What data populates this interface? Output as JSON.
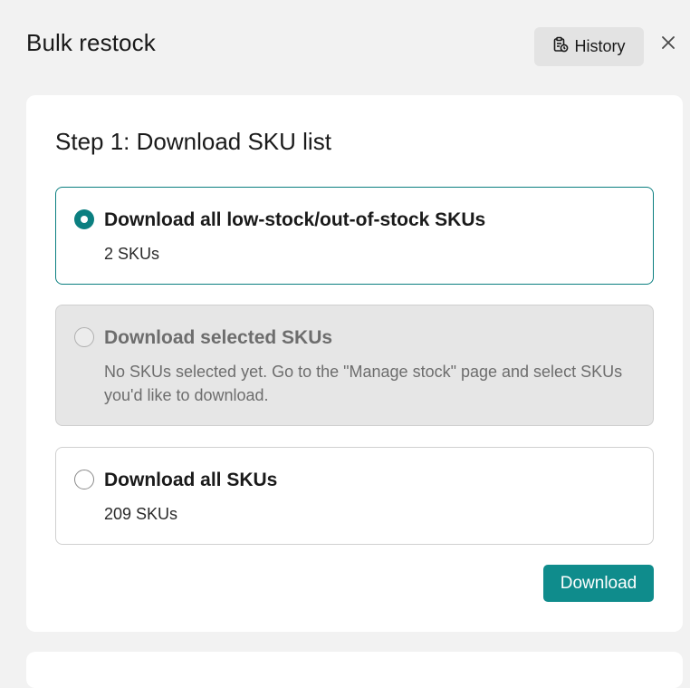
{
  "dialog": {
    "title": "Bulk restock",
    "history_label": "History"
  },
  "step1": {
    "title": "Step 1: Download SKU list",
    "options": [
      {
        "label": "Download all low-stock/out-of-stock SKUs",
        "sub": "2 SKUs",
        "selected": true,
        "disabled": false
      },
      {
        "label": "Download selected SKUs",
        "sub": "No SKUs selected yet. Go to the \"Manage stock\" page and select SKUs you'd like to download.",
        "selected": false,
        "disabled": true
      },
      {
        "label": "Download all SKUs",
        "sub": "209 SKUs",
        "selected": false,
        "disabled": false
      }
    ],
    "download_label": "Download"
  },
  "colors": {
    "accent": "#0f8c8c",
    "selected_border": "#0b7f80",
    "disabled_bg": "#e6e6e6",
    "page_bg": "#f2f2f2"
  }
}
